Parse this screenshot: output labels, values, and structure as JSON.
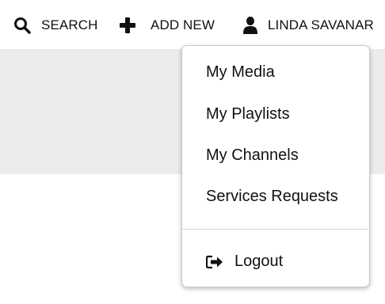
{
  "header": {
    "search_label": "SEARCH",
    "add_new_label": "ADD NEW",
    "user_label": "LINDA SAVANAR"
  },
  "user_menu": {
    "items": [
      {
        "label": "My Media"
      },
      {
        "label": "My Playlists"
      },
      {
        "label": "My Channels"
      },
      {
        "label": "Services Requests"
      }
    ],
    "logout_label": "Logout"
  },
  "icons": {
    "search": "search-icon",
    "add": "plus-icon",
    "user": "user-icon",
    "logout": "logout-icon"
  },
  "colors": {
    "text": "#111111",
    "band": "#ececec",
    "menu_border": "#c8c8c8"
  }
}
